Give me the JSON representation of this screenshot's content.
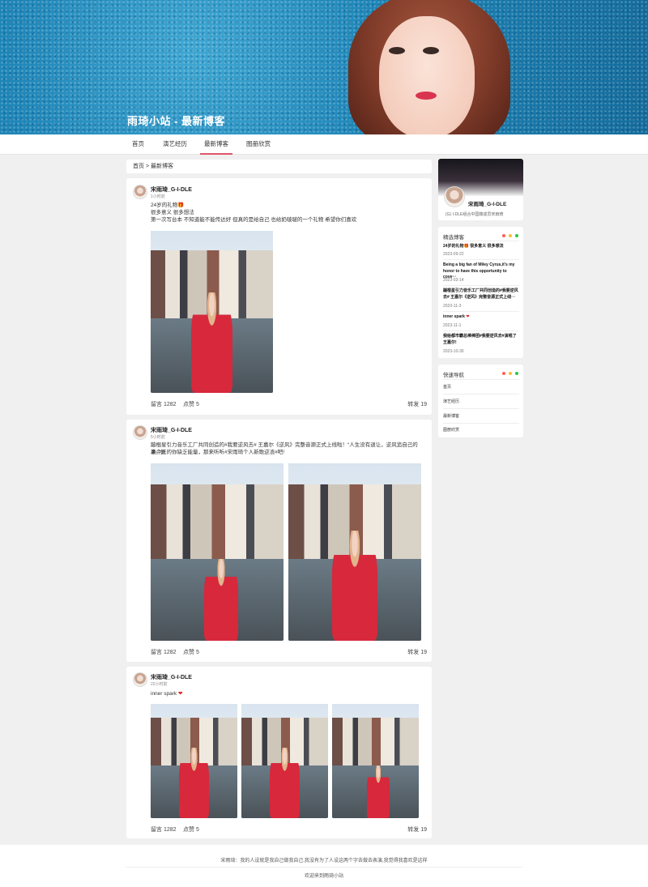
{
  "banner": {
    "title": "雨琦小站 - 最新博客"
  },
  "nav": {
    "items": [
      "首页",
      "演艺经历",
      "最新博客",
      "图册欣赏"
    ],
    "active": "最新博客"
  },
  "breadcrumb": "首页 > 最新博客",
  "posts": [
    {
      "author": "宋雨琦_G-I-DLE",
      "time": "1小时前",
      "lines": [
        "24岁的礼物🎁",
        "很多意义 很多想法",
        "第一次写台本 不知道能不能传达好 但真的是给自己 也给奶啵啵的一个礼物 希望你们喜欢"
      ],
      "comments": "留言 1282",
      "likes": "点赞 5",
      "reposts": "转发 19"
    },
    {
      "author": "宋雨琦_G-I-DLE",
      "time": "5小时前",
      "lines": [
        "蹦棍星引力音乐工厂共同创造的#我要逆风去# 王嘉尔《逆风》完整音源正式上线啦！“人生没有退让，逆风追自己的浪。”如",
        "果今天的你缺乏能量，那来听听#宋雨琦个人新歌逆浪#吧!"
      ],
      "comments": "留言 1282",
      "likes": "点赞 5",
      "reposts": "转发 19"
    },
    {
      "author": "宋雨琦_G-I-DLE",
      "time": "22小时前",
      "lines": [
        "inner spark"
      ],
      "comments": "留言 1282",
      "likes": "点赞 5",
      "reposts": "转发 19"
    }
  ],
  "profile": {
    "name": "宋雨琦_G-I-DLE",
    "desc": "(G) I-DLE组合中国籍成员宋雨琦"
  },
  "selected": {
    "title": "精选博客",
    "items": [
      {
        "text": "24岁的礼物🎁 很多意义 很多想法",
        "date": "2023-09-22"
      },
      {
        "text": "Being a big fan of Miley Cyrus,it’s my honor to have this opportunity to cove···",
        "date": "2023-03-14"
      },
      {
        "text": "蹦棍星引力音乐工厂共同创造的#我要逆风去# 王嘉尔《逆风》完整音源正式上线···",
        "date": "2023-11-3"
      },
      {
        "text": "inner spark",
        "date": "2023-11-1"
      },
      {
        "text": "我给都市霸总棒棒团#我要逆风去#演唱了王嘉尔!",
        "date": "2023-10-30"
      }
    ]
  },
  "quicknav": {
    "title": "快速导航",
    "items": [
      "首页",
      "演艺经历",
      "最新博客",
      "图册欣赏"
    ]
  },
  "footer": {
    "quote": "宋雨琦：我的人设就是我自己做我自己,我没有为了人设这两个字去做去表演,我觉得我喜欢是这样",
    "welcome": "欢迎来到雨琦小站"
  },
  "colors": {
    "accent": "#e0566b",
    "dot_red": "#ff5f57",
    "dot_yellow": "#febc2e",
    "dot_green": "#28c840"
  }
}
